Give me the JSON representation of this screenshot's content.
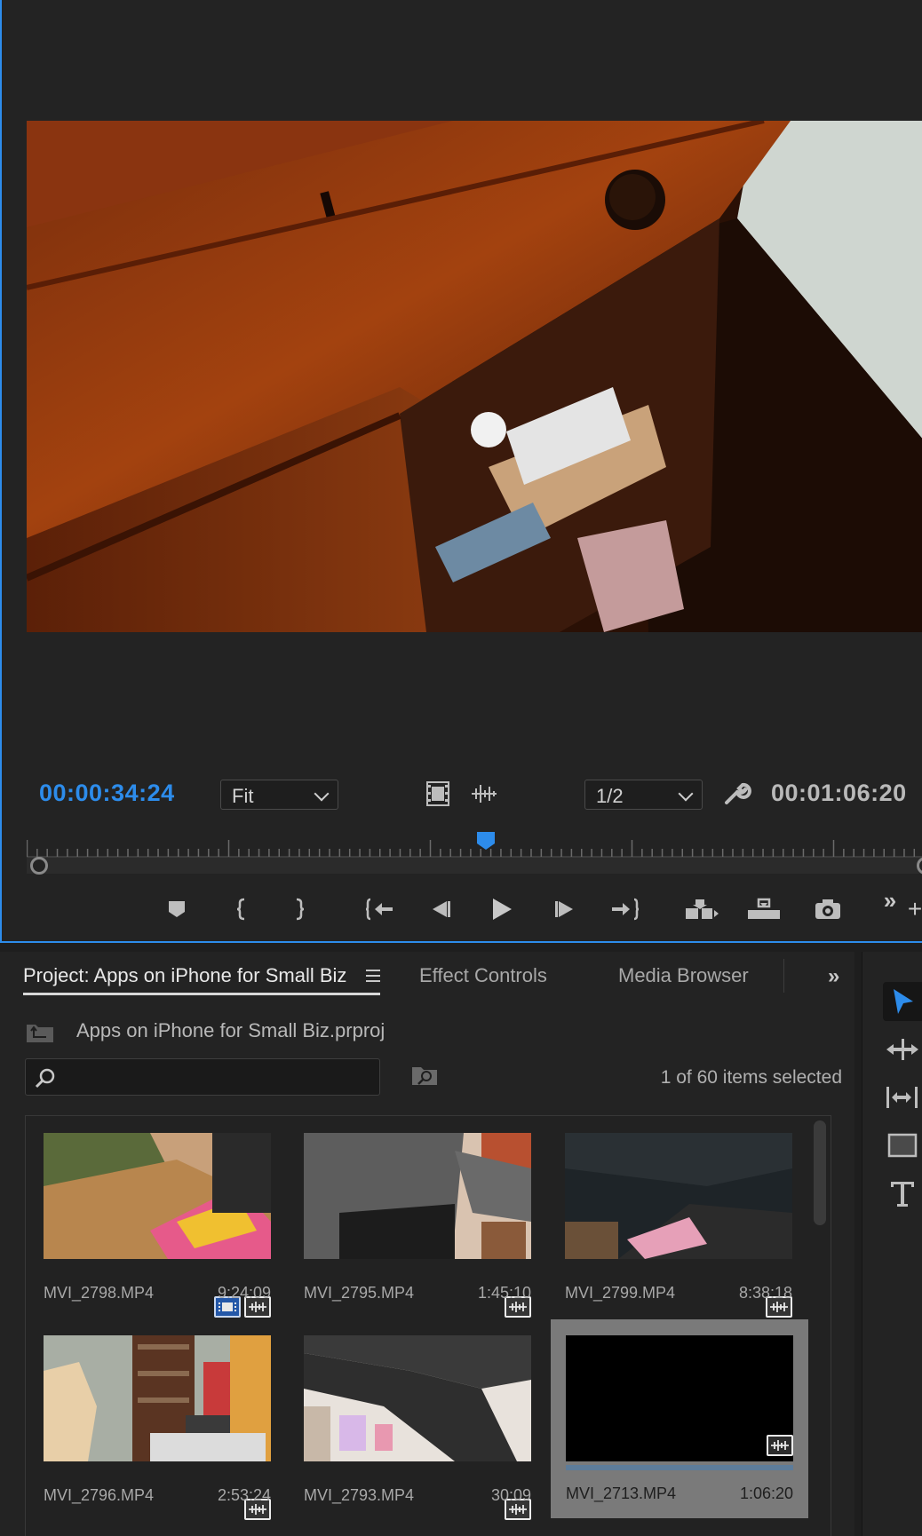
{
  "monitor": {
    "timecode_current": "00:00:34:24",
    "timecode_duration": "00:01:06:20",
    "zoom": "Fit",
    "resolution": "1/2",
    "playhead_fraction": 0.512
  },
  "project": {
    "tabs": [
      {
        "label": "Project: Apps on iPhone for Small Biz",
        "active": true
      },
      {
        "label": "Effect Controls",
        "active": false
      },
      {
        "label": "Media Browser",
        "active": false
      }
    ],
    "file_name": "Apps on iPhone for Small Biz.prproj",
    "search_placeholder": "",
    "selection_status": "1 of 60 items selected",
    "clips": [
      {
        "name": "MVI_2798.MP4",
        "duration": "9:24:09",
        "has_video_badge": true,
        "selected": false
      },
      {
        "name": "MVI_2795.MP4",
        "duration": "1:45:10",
        "has_video_badge": false,
        "selected": false
      },
      {
        "name": "MVI_2799.MP4",
        "duration": "8:38:18",
        "has_video_badge": false,
        "selected": false
      },
      {
        "name": "MVI_2796.MP4",
        "duration": "2:53:24",
        "has_video_badge": false,
        "selected": false
      },
      {
        "name": "MVI_2793.MP4",
        "duration": "30:09",
        "has_video_badge": false,
        "selected": false
      },
      {
        "name": "MVI_2713.MP4",
        "duration": "1:06:20",
        "has_video_badge": false,
        "selected": true,
        "progress": 1.0
      }
    ]
  },
  "colors": {
    "accent": "#2d8ceb",
    "panel": "#232323",
    "selected_clip": "#7a7a7a"
  },
  "icons": [
    "film-strip-icon",
    "audio-waveform-icon",
    "wrench-icon",
    "marker-icon",
    "mark-in-icon",
    "mark-out-icon",
    "go-to-in-icon",
    "step-back-icon",
    "play-icon",
    "step-forward-icon",
    "go-to-out-icon",
    "insert-icon",
    "overwrite-icon",
    "camera-icon",
    "overflow-icon",
    "search-icon",
    "bin-search-icon",
    "folder-up-icon",
    "selection-tool-icon",
    "ripple-edit-icon",
    "slip-tool-icon",
    "rectangle-tool-icon",
    "type-tool-icon"
  ]
}
